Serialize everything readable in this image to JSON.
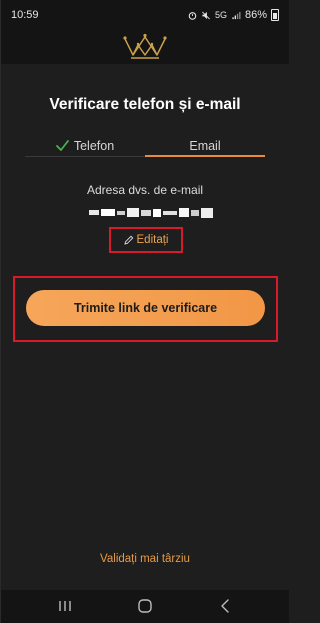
{
  "status_bar": {
    "time": "10:59",
    "battery_percent": "86%",
    "icons": [
      "alarm-icon",
      "mute-icon",
      "5g-icon",
      "signal-icon",
      "battery-icon"
    ],
    "network": "5G"
  },
  "header": {
    "logo": "crown-icon",
    "accent_color": "#c9a14a"
  },
  "page": {
    "title": "Verificare telefon și e-mail"
  },
  "tabs": [
    {
      "label": "Telefon",
      "completed": true,
      "icon": "check-icon"
    },
    {
      "label": "Email",
      "active": true
    }
  ],
  "email_section": {
    "label": "Adresa dvs. de e-mail",
    "edit_label": "Editați",
    "edit_icon": "pencil-icon"
  },
  "actions": {
    "send_label": "Trimite link de verificare",
    "later_label": "Validați mai târziu"
  },
  "nav": {
    "icons": [
      "recents-icon",
      "home-icon",
      "back-icon"
    ]
  },
  "colors": {
    "background": "#1e1e1e",
    "accent": "#f19746",
    "highlight_border": "#d81b2c",
    "check": "#4caf50"
  }
}
